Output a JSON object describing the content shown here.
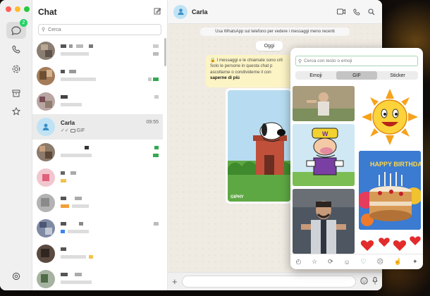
{
  "rail": {
    "badge_count": "2",
    "icons": [
      "chats-icon",
      "phone-icon",
      "status-icon",
      "archive-icon",
      "star-icon",
      "settings-icon"
    ]
  },
  "chatlist": {
    "title": "Chat",
    "search_placeholder": "Cerca",
    "active_chat": {
      "name": "Carla",
      "time": "09:55",
      "preview": "GIF"
    }
  },
  "conversation": {
    "contact_name": "Carla",
    "notice": "Usa WhatsApp sul telefono per vedere i messaggi meno recenti",
    "date_label": "Oggi",
    "e2e_line1": "I messaggi e le chiamate sono crit",
    "e2e_line2": "Solo le persone in questa chat p",
    "e2e_line3": "ascoltarne o condividerne il con",
    "e2e_link": "saperne di più",
    "gif_watermark": "GIPHY"
  },
  "picker": {
    "search_placeholder": "Cerca con testo o emoji",
    "tabs": [
      "Emoji",
      "GIF",
      "Sticker"
    ],
    "active_tab": "GIF",
    "gif_text_birthday": "HAPPY BIRTHDAY"
  },
  "colors": {
    "accent": "#25d366",
    "e2e_bg": "#fdf4c5",
    "chat_bg": "#efeae2"
  }
}
